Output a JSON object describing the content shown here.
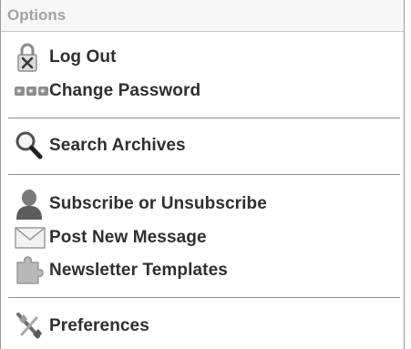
{
  "panel": {
    "title": "Options"
  },
  "items": {
    "log_out": {
      "label": "Log Out",
      "icon": "padlock-x-icon"
    },
    "change_password": {
      "label": "Change Password",
      "icon": "password-asterisks-icon"
    },
    "search_archives": {
      "label": "Search Archives",
      "icon": "magnifier-icon"
    },
    "subscribe": {
      "label": "Subscribe or Unsubscribe",
      "icon": "user-icon"
    },
    "post_message": {
      "label": "Post New Message",
      "icon": "envelope-icon"
    },
    "newsletter_templates": {
      "label": "Newsletter Templates",
      "icon": "puzzle-piece-icon"
    },
    "preferences": {
      "label": "Preferences",
      "icon": "tools-icon"
    }
  }
}
